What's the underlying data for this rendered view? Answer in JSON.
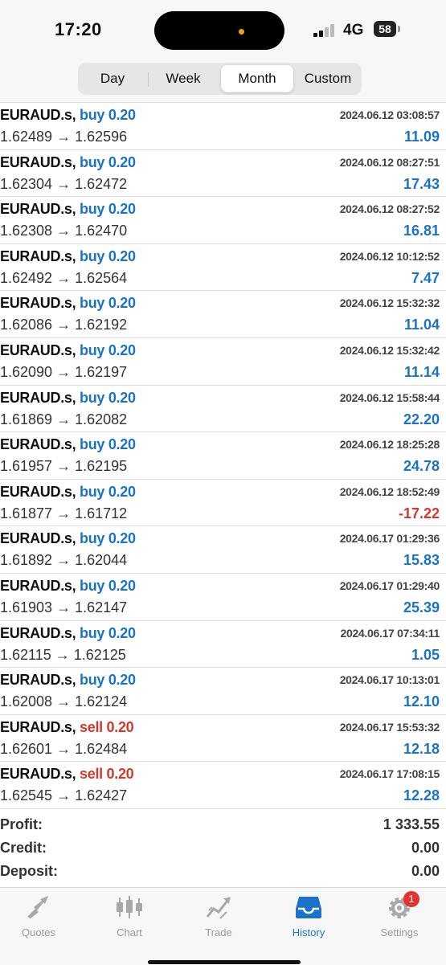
{
  "status_bar": {
    "time": "17:20",
    "network": "4G",
    "battery": "58"
  },
  "period_tabs": [
    {
      "label": "Day",
      "active": false
    },
    {
      "label": "Week",
      "active": false
    },
    {
      "label": "Month",
      "active": true
    },
    {
      "label": "Custom",
      "active": false
    }
  ],
  "deals": [
    {
      "symbol": "EURAUD.s,",
      "side": "buy 0.20",
      "type": "buy",
      "prices": "1.62489 → 1.62596",
      "datetime": "2024.06.12 03:08:57",
      "profit": "11.09",
      "sign": "pos"
    },
    {
      "symbol": "EURAUD.s,",
      "side": "buy 0.20",
      "type": "buy",
      "prices": "1.62304 → 1.62472",
      "datetime": "2024.06.12 08:27:51",
      "profit": "17.43",
      "sign": "pos"
    },
    {
      "symbol": "EURAUD.s,",
      "side": "buy 0.20",
      "type": "buy",
      "prices": "1.62308 → 1.62470",
      "datetime": "2024.06.12 08:27:52",
      "profit": "16.81",
      "sign": "pos"
    },
    {
      "symbol": "EURAUD.s,",
      "side": "buy 0.20",
      "type": "buy",
      "prices": "1.62492 → 1.62564",
      "datetime": "2024.06.12 10:12:52",
      "profit": "7.47",
      "sign": "pos"
    },
    {
      "symbol": "EURAUD.s,",
      "side": "buy 0.20",
      "type": "buy",
      "prices": "1.62086 → 1.62192",
      "datetime": "2024.06.12 15:32:32",
      "profit": "11.04",
      "sign": "pos"
    },
    {
      "symbol": "EURAUD.s,",
      "side": "buy 0.20",
      "type": "buy",
      "prices": "1.62090 → 1.62197",
      "datetime": "2024.06.12 15:32:42",
      "profit": "11.14",
      "sign": "pos"
    },
    {
      "symbol": "EURAUD.s,",
      "side": "buy 0.20",
      "type": "buy",
      "prices": "1.61869 → 1.62082",
      "datetime": "2024.06.12 15:58:44",
      "profit": "22.20",
      "sign": "pos"
    },
    {
      "symbol": "EURAUD.s,",
      "side": "buy 0.20",
      "type": "buy",
      "prices": "1.61957 → 1.62195",
      "datetime": "2024.06.12 18:25:28",
      "profit": "24.78",
      "sign": "pos"
    },
    {
      "symbol": "EURAUD.s,",
      "side": "buy 0.20",
      "type": "buy",
      "prices": "1.61877 → 1.61712",
      "datetime": "2024.06.12 18:52:49",
      "profit": "-17.22",
      "sign": "neg"
    },
    {
      "symbol": "EURAUD.s,",
      "side": "buy 0.20",
      "type": "buy",
      "prices": "1.61892 → 1.62044",
      "datetime": "2024.06.17 01:29:36",
      "profit": "15.83",
      "sign": "pos"
    },
    {
      "symbol": "EURAUD.s,",
      "side": "buy 0.20",
      "type": "buy",
      "prices": "1.61903 → 1.62147",
      "datetime": "2024.06.17 01:29:40",
      "profit": "25.39",
      "sign": "pos"
    },
    {
      "symbol": "EURAUD.s,",
      "side": "buy 0.20",
      "type": "buy",
      "prices": "1.62115 → 1.62125",
      "datetime": "2024.06.17 07:34:11",
      "profit": "1.05",
      "sign": "pos"
    },
    {
      "symbol": "EURAUD.s,",
      "side": "buy 0.20",
      "type": "buy",
      "prices": "1.62008 → 1.62124",
      "datetime": "2024.06.17 10:13:01",
      "profit": "12.10",
      "sign": "pos"
    },
    {
      "symbol": "EURAUD.s,",
      "side": "sell 0.20",
      "type": "sell",
      "prices": "1.62601 → 1.62484",
      "datetime": "2024.06.17 15:53:32",
      "profit": "12.18",
      "sign": "pos"
    },
    {
      "symbol": "EURAUD.s,",
      "side": "sell 0.20",
      "type": "sell",
      "prices": "1.62545 → 1.62427",
      "datetime": "2024.06.17 17:08:15",
      "profit": "12.28",
      "sign": "pos"
    }
  ],
  "summary": [
    {
      "label": "Profit:",
      "value": "1 333.55"
    },
    {
      "label": "Credit:",
      "value": "0.00"
    },
    {
      "label": "Deposit:",
      "value": "0.00"
    }
  ],
  "tabbar": {
    "items": [
      {
        "label": "Quotes",
        "icon": "quotes-icon",
        "active": false
      },
      {
        "label": "Chart",
        "icon": "candlestick-chart-icon",
        "active": false
      },
      {
        "label": "Trade",
        "icon": "trade-icon",
        "active": false
      },
      {
        "label": "History",
        "icon": "inbox-history-icon",
        "active": true
      },
      {
        "label": "Settings",
        "icon": "gear-icon",
        "active": false
      }
    ],
    "settings_badge": "1"
  },
  "colors": {
    "accent": "#1a73c8",
    "negative": "#d03a2e",
    "badge": "#e5322d"
  }
}
